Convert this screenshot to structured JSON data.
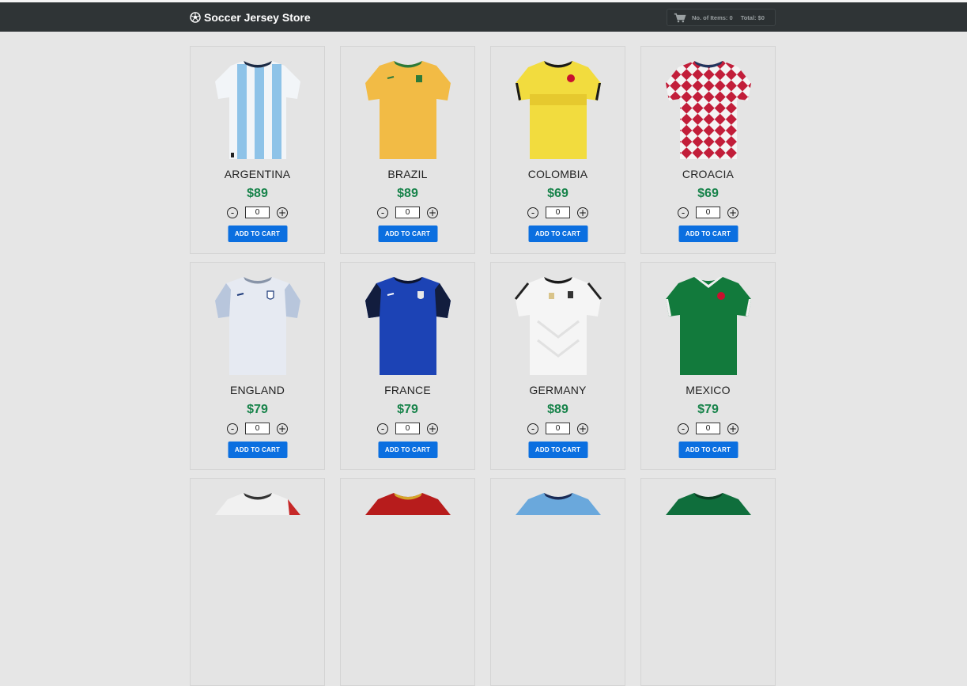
{
  "store": {
    "title": "Soccer Jersey Store",
    "logo_icon": "soccer-ball-icon",
    "cart_icon": "shopping-cart-icon",
    "items_label": "No. of Items: 0",
    "total_label": "Total: $0"
  },
  "colors": {
    "navbar": "#2f3436",
    "price": "#17834a",
    "button": "#0b6fe0",
    "background": "#e6e6e6"
  },
  "add_label": "ADD TO CART",
  "products": [
    {
      "name": "ARGENTINA",
      "price": "$89",
      "qty": "0",
      "minus": "-",
      "plus": "+"
    },
    {
      "name": "BRAZIL",
      "price": "$89",
      "qty": "0",
      "minus": "-",
      "plus": "+"
    },
    {
      "name": "COLOMBIA",
      "price": "$69",
      "qty": "0",
      "minus": "-",
      "plus": "+"
    },
    {
      "name": "CROACIA",
      "price": "$69",
      "qty": "0",
      "minus": "-",
      "plus": "+"
    },
    {
      "name": "ENGLAND",
      "price": "$79",
      "qty": "0",
      "minus": "-",
      "plus": "+"
    },
    {
      "name": "FRANCE",
      "price": "$79",
      "qty": "0",
      "minus": "-",
      "plus": "+"
    },
    {
      "name": "GERMANY",
      "price": "$89",
      "qty": "0",
      "minus": "-",
      "plus": "+"
    },
    {
      "name": "MEXICO",
      "price": "$79",
      "qty": "0",
      "minus": "-",
      "plus": "+"
    }
  ]
}
